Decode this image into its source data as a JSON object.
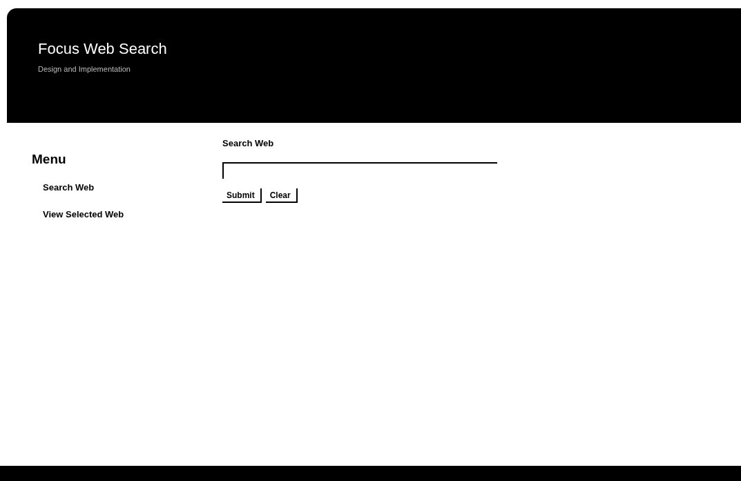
{
  "header": {
    "title": "Focus Web Search",
    "subtitle": "Design and Implementation"
  },
  "menu": {
    "heading": "Menu",
    "items": [
      {
        "label": "Search Web"
      },
      {
        "label": "View Selected Web"
      }
    ]
  },
  "search": {
    "label": "Search Web",
    "buttons": [
      "Submit",
      "Clear"
    ]
  }
}
